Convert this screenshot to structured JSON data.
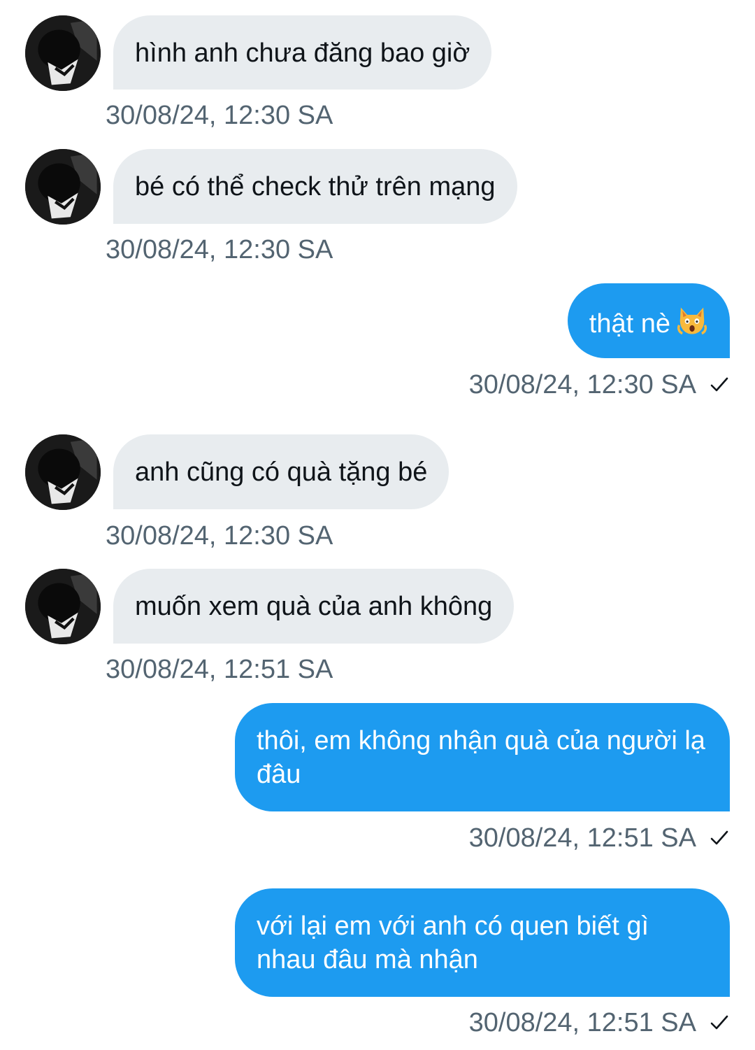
{
  "messages": [
    {
      "text": "hình anh chưa đăng bao giờ",
      "time": "30/08/24, 12:30 SA"
    },
    {
      "text": "bé có thể check thử trên mạng",
      "time": "30/08/24, 12:30 SA"
    },
    {
      "text": "thật nè",
      "emoji": "weary-cat-face-icon",
      "time": "30/08/24, 12:30 SA"
    },
    {
      "text": "anh cũng có quà tặng bé",
      "time": "30/08/24, 12:30 SA"
    },
    {
      "text": "muốn xem quà của anh không",
      "time": "30/08/24, 12:51 SA"
    },
    {
      "text": "thôi, em không nhận quà của người lạ đâu",
      "time": "30/08/24, 12:51 SA"
    },
    {
      "text": "với lại em với anh có quen biết gì nhau đâu mà nhận",
      "time": "30/08/24, 12:51 SA"
    }
  ],
  "colors": {
    "incoming_bubble": "#e8ecef",
    "outgoing_bubble": "#1d9bf0",
    "timestamp": "#536471"
  },
  "icons": {
    "sent_status": "checkmark-icon",
    "avatar": "user-avatar"
  }
}
